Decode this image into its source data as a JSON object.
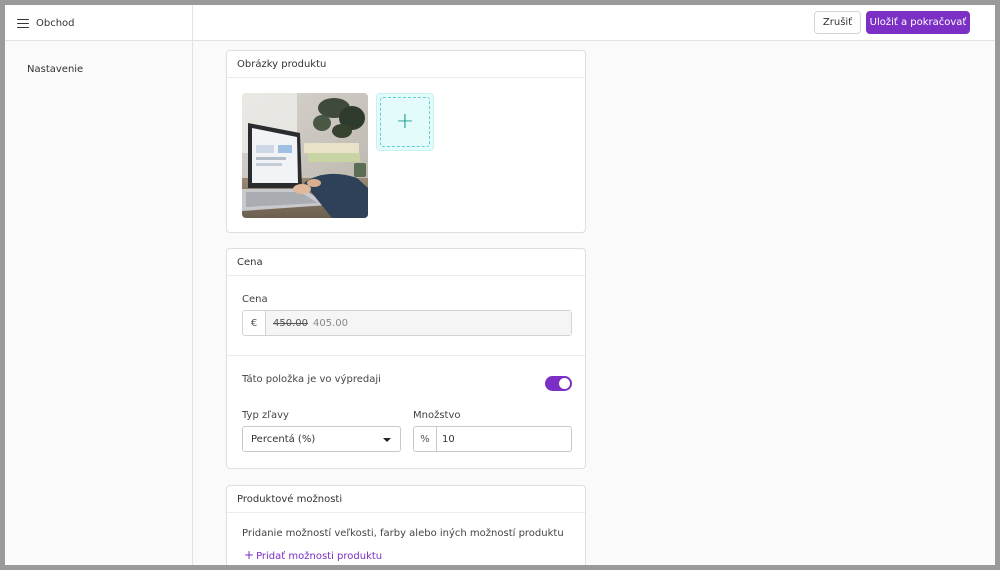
{
  "header": {
    "app_title": "Obchod",
    "cancel_label": "Zrušiť",
    "save_label": "Uložiť a pokračovať"
  },
  "sidebar": {
    "items": [
      {
        "label": "Nastavenie"
      }
    ]
  },
  "images_card": {
    "title": "Obrázky produktu",
    "add_icon": "+"
  },
  "price_card": {
    "title": "Cena",
    "price_label": "Cena",
    "currency": "€",
    "old_price": "450.00",
    "new_price": "405.00",
    "sale_label": "Táto položka je vo výpredaji",
    "sale_enabled": true,
    "discount_type_label": "Typ zľavy",
    "discount_type_value": "Percentá (%)",
    "amount_label": "Množstvo",
    "amount_unit": "%",
    "amount_value": "10"
  },
  "options_card": {
    "title": "Produktové možnosti",
    "description": "Pridanie možností veľkosti, farby alebo iných možností produktu",
    "add_icon": "+",
    "add_label": "Pridať možnosti produktu"
  },
  "colors": {
    "accent": "#7b2fc4",
    "teal": "#1a9a8e"
  }
}
